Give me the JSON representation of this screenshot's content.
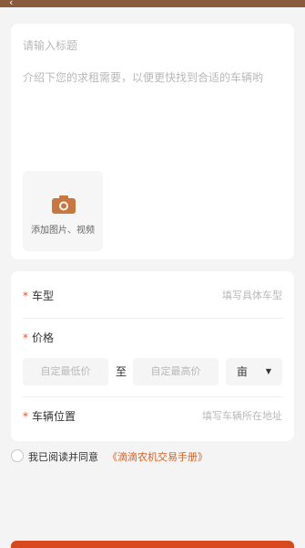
{
  "header": {
    "back_icon": "back-arrow-icon",
    "title": ""
  },
  "form": {
    "title_placeholder": "请输入标题",
    "description_placeholder": "介绍下您的求租需要，以便更快找到合适的车辆哟",
    "upload_label": "添加图片、视频",
    "upload_icon": "camera-icon",
    "required_mark": "*",
    "vehicle_type": {
      "label": "车型",
      "placeholder": "填写具体车型"
    },
    "price": {
      "label": "价格",
      "min_placeholder": "自定最低价",
      "to_label": "至",
      "max_placeholder": "自定最高价",
      "unit_value": "亩",
      "unit_caret": "▼"
    },
    "location": {
      "label": "车辆位置",
      "placeholder": "填写车辆所在地址"
    }
  },
  "agreement": {
    "text": "我已阅读并同意",
    "link": "《滴滴农机交易手册》"
  },
  "colors": {
    "accent": "#d0632a",
    "required": "#e2522f",
    "header": "#8a5a3c",
    "button": "#d9481f"
  }
}
